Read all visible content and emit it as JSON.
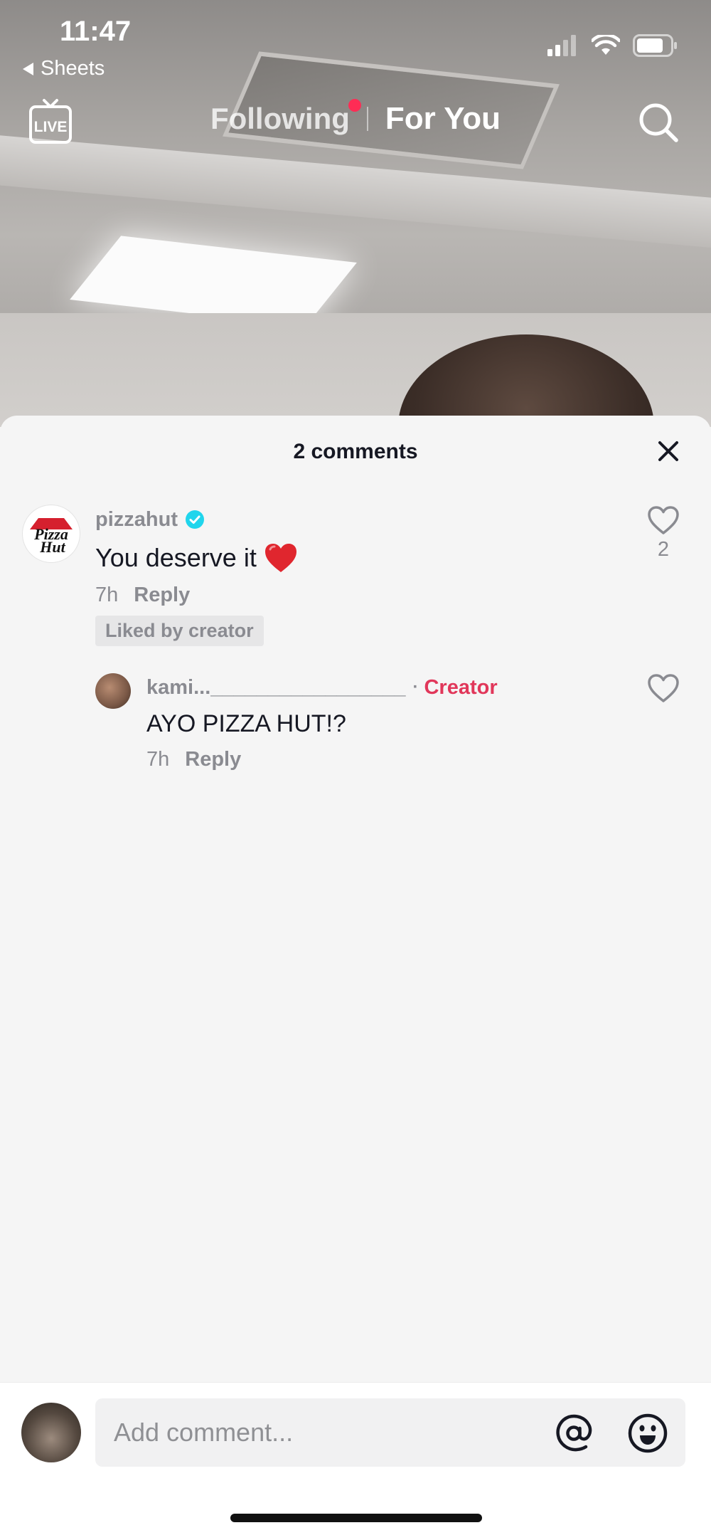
{
  "status_bar": {
    "time": "11:47",
    "back_app": "Sheets",
    "icons": [
      "signal-icon",
      "wifi-icon",
      "battery-icon"
    ]
  },
  "top_nav": {
    "live_label": "LIVE",
    "tabs": [
      {
        "label": "Following",
        "has_notification_dot": true,
        "active": false
      },
      {
        "label": "For You",
        "active": true
      }
    ],
    "search_icon": "search-icon"
  },
  "comments_sheet": {
    "title": "2 comments",
    "close_icon": "close-icon",
    "comments": [
      {
        "username": "pizzahut",
        "verified": true,
        "avatar_logo_text": "Pizza Hut",
        "text": "You deserve it",
        "emoji": "❤️",
        "time": "7h",
        "reply_label": "Reply",
        "badge": "Liked by creator",
        "like_count": "2",
        "replies": [
          {
            "username": "kami..._________________",
            "creator_separator": "·",
            "creator_label": "Creator",
            "text": "AYO PIZZA HUT!?",
            "time": "7h",
            "reply_label": "Reply"
          }
        ]
      }
    ]
  },
  "composer": {
    "placeholder": "Add comment...",
    "mention_icon": "at-icon",
    "emoji_icon": "emoji-icon"
  },
  "colors": {
    "accent_red": "#fe2c55",
    "creator_red": "#e1375a",
    "verified_blue": "#20d5ec",
    "pizza_hut_red": "#d5202e"
  }
}
